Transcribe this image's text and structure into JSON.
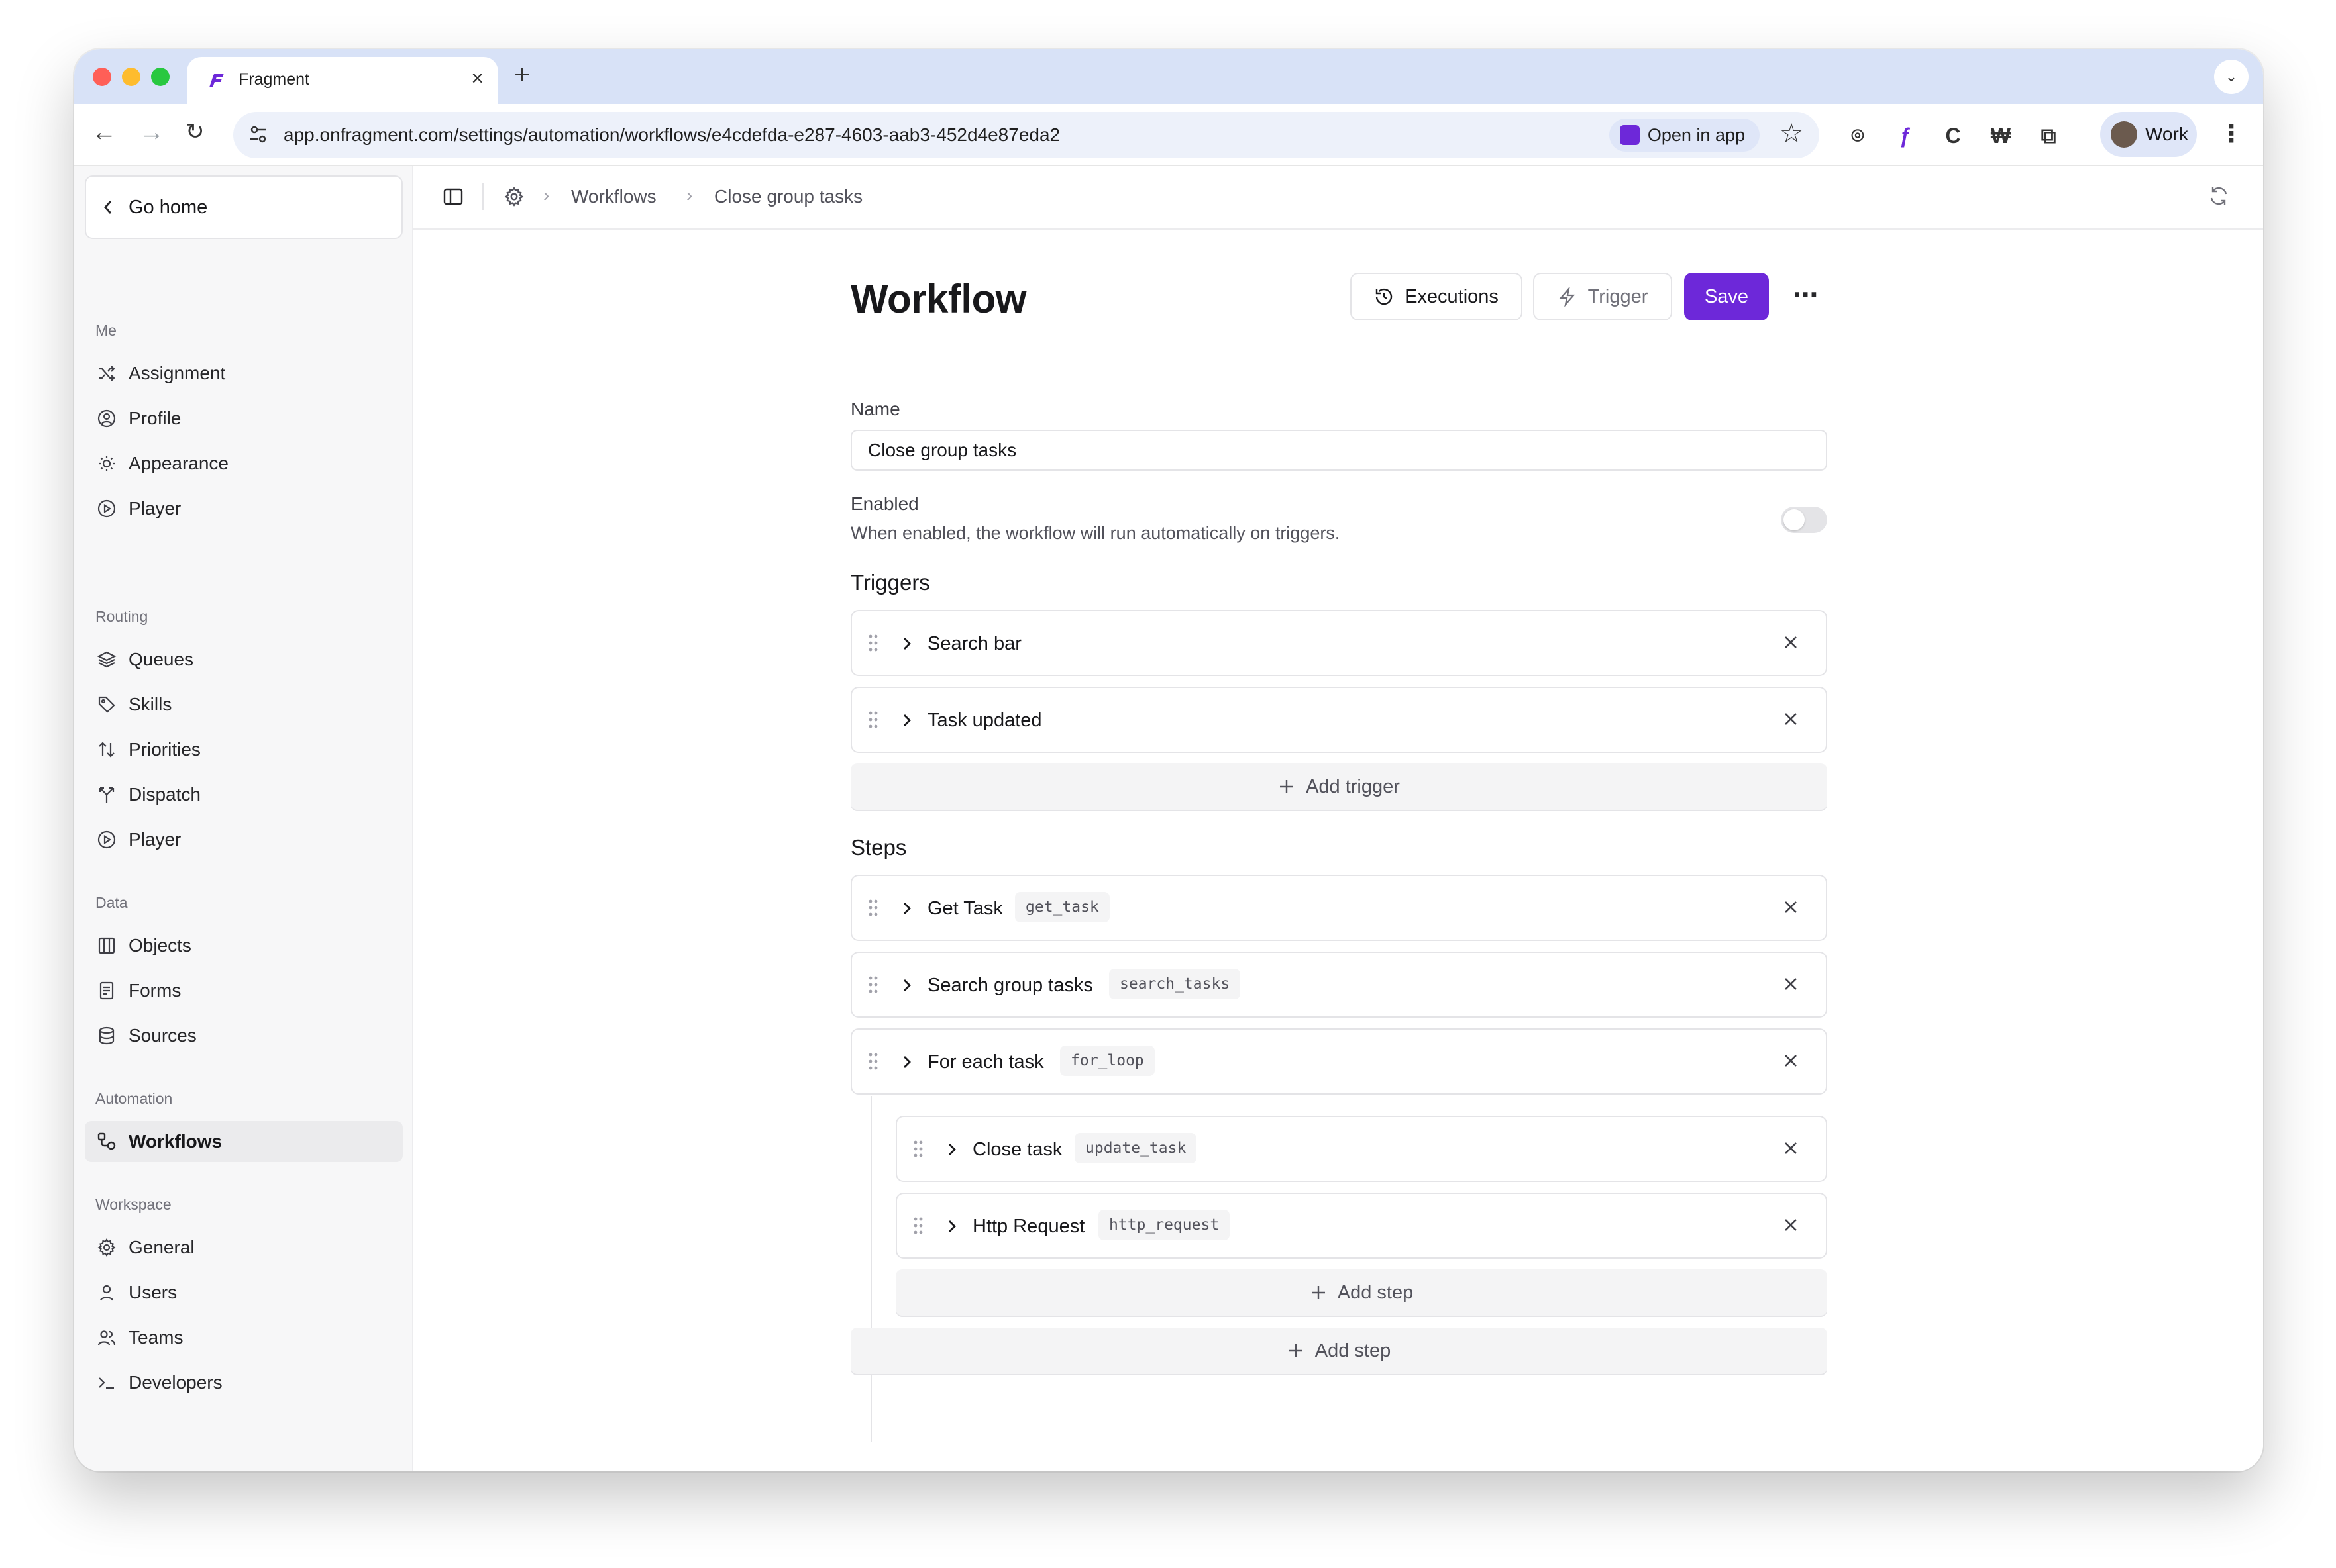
{
  "browser": {
    "tab_title": "Fragment",
    "url": "app.onfragment.com/settings/automation/workflows/e4cdefda-e287-4603-aab3-452d4e87eda2",
    "open_in_app": "Open in app",
    "profile_name": "Work"
  },
  "sidebar": {
    "go_home": "Go home",
    "sections": {
      "me": {
        "label": "Me",
        "items": [
          "Assignment",
          "Profile",
          "Appearance",
          "Player"
        ]
      },
      "routing": {
        "label": "Routing",
        "items": [
          "Queues",
          "Skills",
          "Priorities",
          "Dispatch",
          "Player"
        ]
      },
      "data": {
        "label": "Data",
        "items": [
          "Objects",
          "Forms",
          "Sources"
        ]
      },
      "automation": {
        "label": "Automation",
        "items": [
          "Workflows"
        ]
      },
      "workspace": {
        "label": "Workspace",
        "items": [
          "General",
          "Users",
          "Teams",
          "Developers"
        ]
      }
    },
    "active_item": "Workflows"
  },
  "breadcrumb": [
    "Workflows",
    "Close group tasks"
  ],
  "page": {
    "title": "Workflow",
    "buttons": {
      "executions": "Executions",
      "trigger": "Trigger",
      "save": "Save"
    },
    "name_label": "Name",
    "name_value": "Close group tasks",
    "enabled_label": "Enabled",
    "enabled_help": "When enabled, the workflow will run automatically on triggers.",
    "enabled": false,
    "triggers_title": "Triggers",
    "triggers": [
      "Search bar",
      "Task updated"
    ],
    "add_trigger": "Add trigger",
    "steps_title": "Steps",
    "steps": [
      {
        "label": "Get Task",
        "code": "get_task"
      },
      {
        "label": "Search group tasks",
        "code": "search_tasks"
      },
      {
        "label": "For each task",
        "code": "for_loop"
      }
    ],
    "nested_steps": [
      {
        "label": "Close task",
        "code": "update_task"
      },
      {
        "label": "Http Request",
        "code": "http_request"
      }
    ],
    "add_step_nested": "Add step",
    "add_step": "Add step"
  },
  "colors": {
    "accent": "#6d28d9",
    "tabstrip": "#d8e2f7"
  }
}
